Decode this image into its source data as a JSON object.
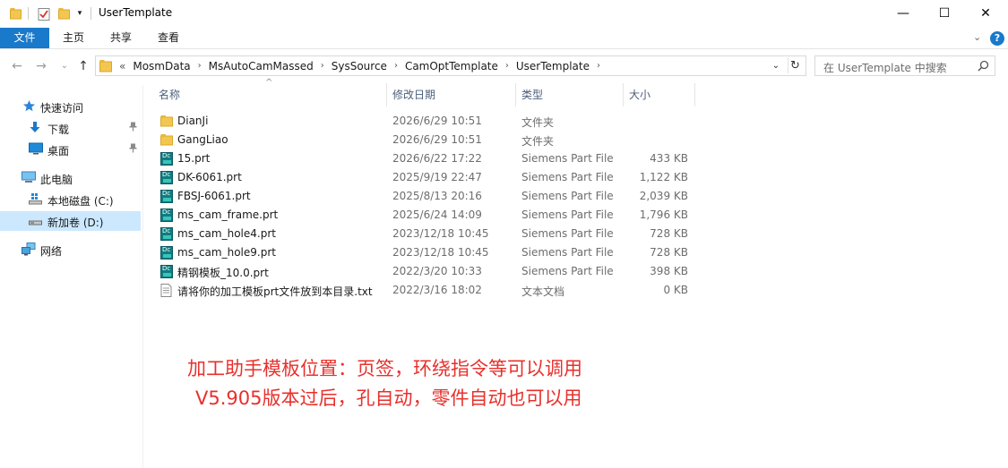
{
  "window": {
    "title": "UserTemplate",
    "minimize_glyph": "—",
    "maximize_glyph": "☐",
    "close_glyph": "✕"
  },
  "ribbon": {
    "tabs": [
      "文件",
      "主页",
      "共享",
      "查看"
    ],
    "expand_glyph": "⌄",
    "help_glyph": "?"
  },
  "nav_buttons": {
    "back": "←",
    "forward": "→",
    "recent": "⌄",
    "up": "↑"
  },
  "address": {
    "overflow": "«",
    "crumbs": [
      "MosmData",
      "MsAutoCamMassed",
      "SysSource",
      "CamOptTemplate",
      "UserTemplate"
    ],
    "separator": "›",
    "dropdown_glyph": "⌄",
    "refresh_glyph": "↻"
  },
  "search": {
    "placeholder": "在 UserTemplate 中搜索"
  },
  "sidebar": {
    "items": [
      {
        "label": "快速访问",
        "icon": "star-icon"
      },
      {
        "label": "下载",
        "icon": "download-icon",
        "pinned": true
      },
      {
        "label": "桌面",
        "icon": "desktop-icon",
        "pinned": true
      },
      {
        "label": "此电脑",
        "icon": "computer-icon"
      },
      {
        "label": "本地磁盘 (C:)",
        "icon": "drive-icon"
      },
      {
        "label": "新加卷 (D:)",
        "icon": "drive-icon",
        "selected": true
      },
      {
        "label": "网络",
        "icon": "network-icon"
      }
    ],
    "pin_glyph": "📌"
  },
  "columns": {
    "name": "名称",
    "date": "修改日期",
    "type": "类型",
    "size": "大小",
    "sort_glyph": "^"
  },
  "files": [
    {
      "name": "DianJi",
      "date": "2026/6/29 10:51",
      "type": "文件夹",
      "size": "",
      "icon": "folder-icon"
    },
    {
      "name": "GangLiao",
      "date": "2026/6/29 10:51",
      "type": "文件夹",
      "size": "",
      "icon": "folder-icon"
    },
    {
      "name": "15.prt",
      "date": "2026/6/22 17:22",
      "type": "Siemens Part File",
      "size": "433 KB",
      "icon": "nx-part-icon"
    },
    {
      "name": "DK-6061.prt",
      "date": "2025/9/19 22:47",
      "type": "Siemens Part File",
      "size": "1,122 KB",
      "icon": "nx-part-icon"
    },
    {
      "name": "FBSJ-6061.prt",
      "date": "2025/8/13 20:16",
      "type": "Siemens Part File",
      "size": "2,039 KB",
      "icon": "nx-part-icon"
    },
    {
      "name": "ms_cam_frame.prt",
      "date": "2025/6/24 14:09",
      "type": "Siemens Part File",
      "size": "1,796 KB",
      "icon": "nx-part-icon"
    },
    {
      "name": "ms_cam_hole4.prt",
      "date": "2023/12/18 10:45",
      "type": "Siemens Part File",
      "size": "728 KB",
      "icon": "nx-part-icon"
    },
    {
      "name": "ms_cam_hole9.prt",
      "date": "2023/12/18 10:45",
      "type": "Siemens Part File",
      "size": "728 KB",
      "icon": "nx-part-icon"
    },
    {
      "name": "精钢模板_10.0.prt",
      "date": "2022/3/20 10:33",
      "type": "Siemens Part File",
      "size": "398 KB",
      "icon": "nx-part-icon"
    },
    {
      "name": "请将你的加工模板prt文件放到本目录.txt",
      "date": "2022/3/16 18:02",
      "type": "文本文档",
      "size": "0 KB",
      "icon": "text-file-icon"
    }
  ],
  "annotation": {
    "line1": "加工助手模板位置：页签，环绕指令等可以调用",
    "line2": "V5.905版本过后，孔自动，零件自动也可以用",
    "color": "#e8302c"
  },
  "colors": {
    "accent": "#1979ca",
    "selected_bg": "#cce8ff",
    "folder": "#f3c74f"
  }
}
